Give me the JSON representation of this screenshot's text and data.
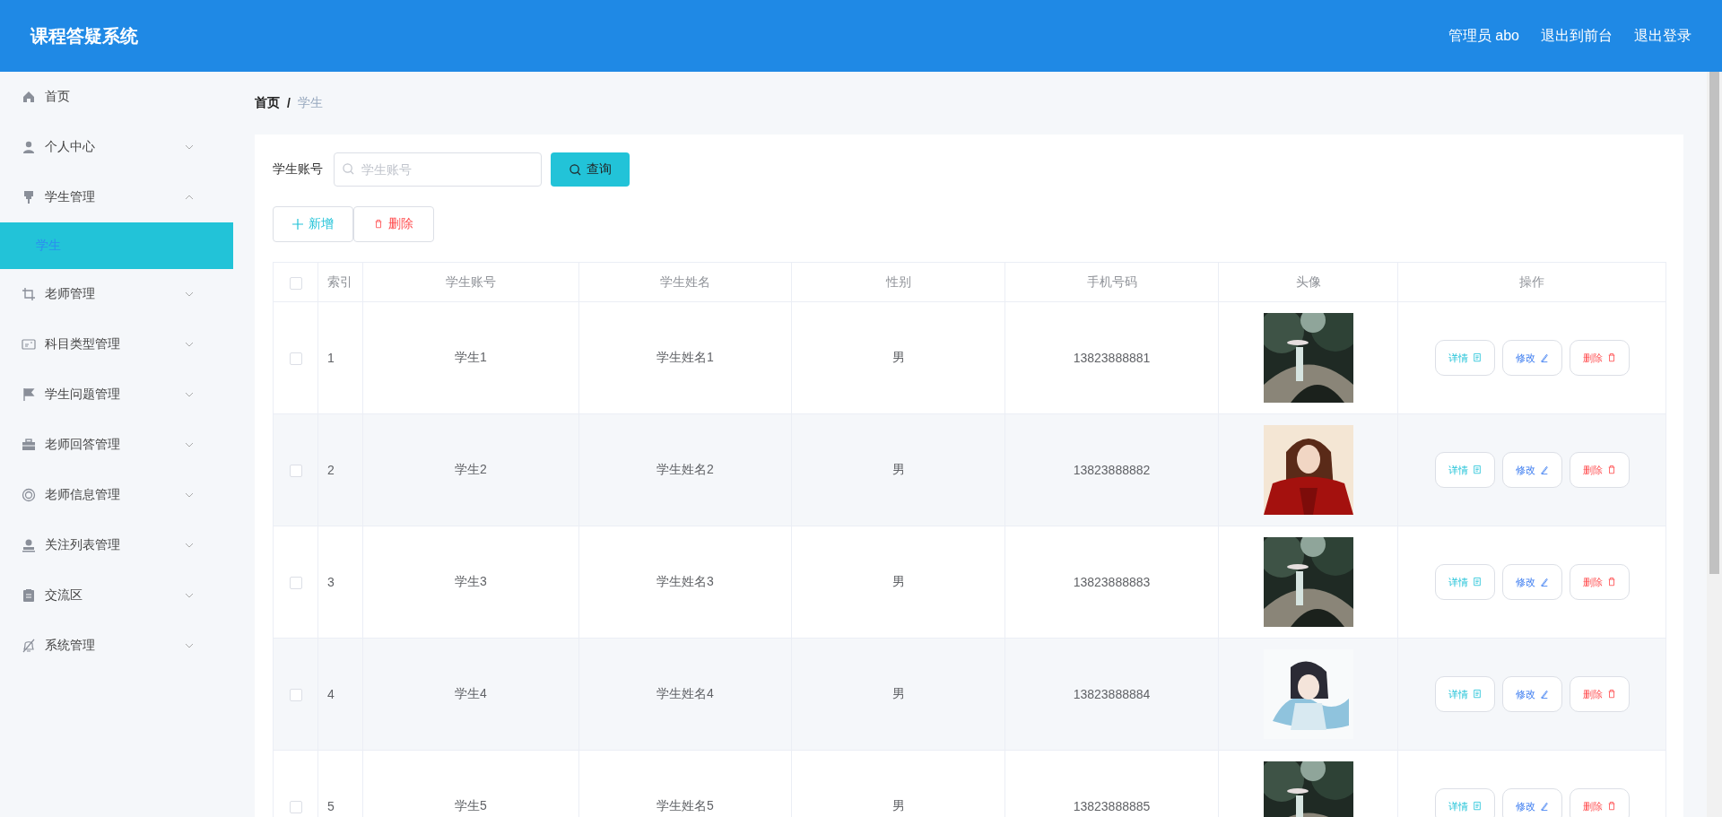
{
  "header": {
    "title": "课程答疑系统",
    "links": [
      "管理员 abo",
      "退出到前台",
      "退出登录"
    ]
  },
  "sidebar": {
    "items": [
      {
        "label": "首页",
        "kind": "link"
      },
      {
        "label": "个人中心",
        "kind": "group",
        "expanded": false
      },
      {
        "label": "学生管理",
        "kind": "group",
        "expanded": true,
        "children": [
          {
            "label": "学生",
            "selected": true
          }
        ]
      },
      {
        "label": "老师管理",
        "kind": "group",
        "expanded": false
      },
      {
        "label": "科目类型管理",
        "kind": "group",
        "expanded": false
      },
      {
        "label": "学生问题管理",
        "kind": "group",
        "expanded": false
      },
      {
        "label": "老师回答管理",
        "kind": "group",
        "expanded": false
      },
      {
        "label": "老师信息管理",
        "kind": "group",
        "expanded": false
      },
      {
        "label": "关注列表管理",
        "kind": "group",
        "expanded": false
      },
      {
        "label": "交流区",
        "kind": "group",
        "expanded": false
      },
      {
        "label": "系统管理",
        "kind": "group",
        "expanded": false
      }
    ]
  },
  "breadcrumb": [
    "首页",
    "/",
    "学生"
  ],
  "search": {
    "label": "学生账号",
    "placeholder": "学生账号",
    "button": "查询"
  },
  "toolbar": {
    "add": "新增",
    "delete": "删除"
  },
  "table": {
    "header_checked": false,
    "columns": [
      "索引",
      "学生账号",
      "学生姓名",
      "性别",
      "手机号码",
      "头像",
      "操作"
    ],
    "rows": [
      {
        "checked": false,
        "index": "1",
        "account": "学生1",
        "name": "学生姓名1",
        "gender": "男",
        "phone": "13823888881",
        "actions": [
          "详情",
          "修改",
          "删除"
        ]
      },
      {
        "checked": false,
        "index": "2",
        "account": "学生2",
        "name": "学生姓名2",
        "gender": "男",
        "phone": "13823888882",
        "actions": [
          "详情",
          "修改",
          "删除"
        ]
      },
      {
        "checked": false,
        "index": "3",
        "account": "学生3",
        "name": "学生姓名3",
        "gender": "男",
        "phone": "13823888883",
        "actions": [
          "详情",
          "修改",
          "删除"
        ]
      },
      {
        "checked": false,
        "index": "4",
        "account": "学生4",
        "name": "学生姓名4",
        "gender": "男",
        "phone": "13823888884",
        "actions": [
          "详情",
          "修改",
          "删除"
        ]
      },
      {
        "checked": false,
        "index": "5",
        "account": "学生5",
        "name": "学生姓名5",
        "gender": "男",
        "phone": "13823888885",
        "actions": [
          "详情",
          "修改",
          "删除"
        ]
      }
    ]
  }
}
